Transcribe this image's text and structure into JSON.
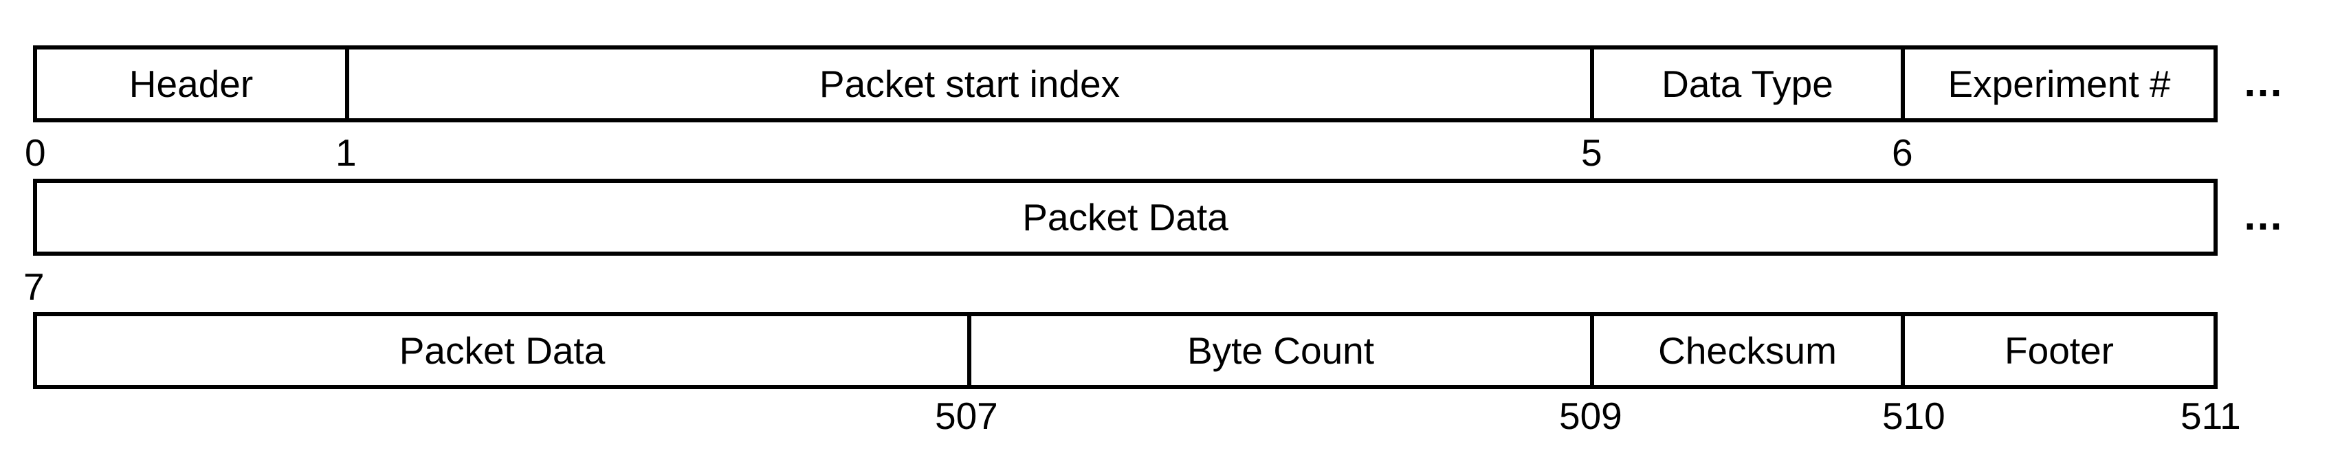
{
  "rows": [
    {
      "fields": [
        "Header",
        "Packet start index",
        "Data Type",
        "Experiment #"
      ],
      "indices": [
        "0",
        "1",
        "5",
        "6"
      ],
      "continuation": "…"
    },
    {
      "fields": [
        "Packet Data"
      ],
      "indices": [
        "7"
      ],
      "continuation": "…"
    },
    {
      "fields": [
        "Packet Data",
        "Byte Count",
        "Checksum",
        "Footer"
      ],
      "indices": [
        "507",
        "509",
        "510",
        "511"
      ]
    }
  ]
}
